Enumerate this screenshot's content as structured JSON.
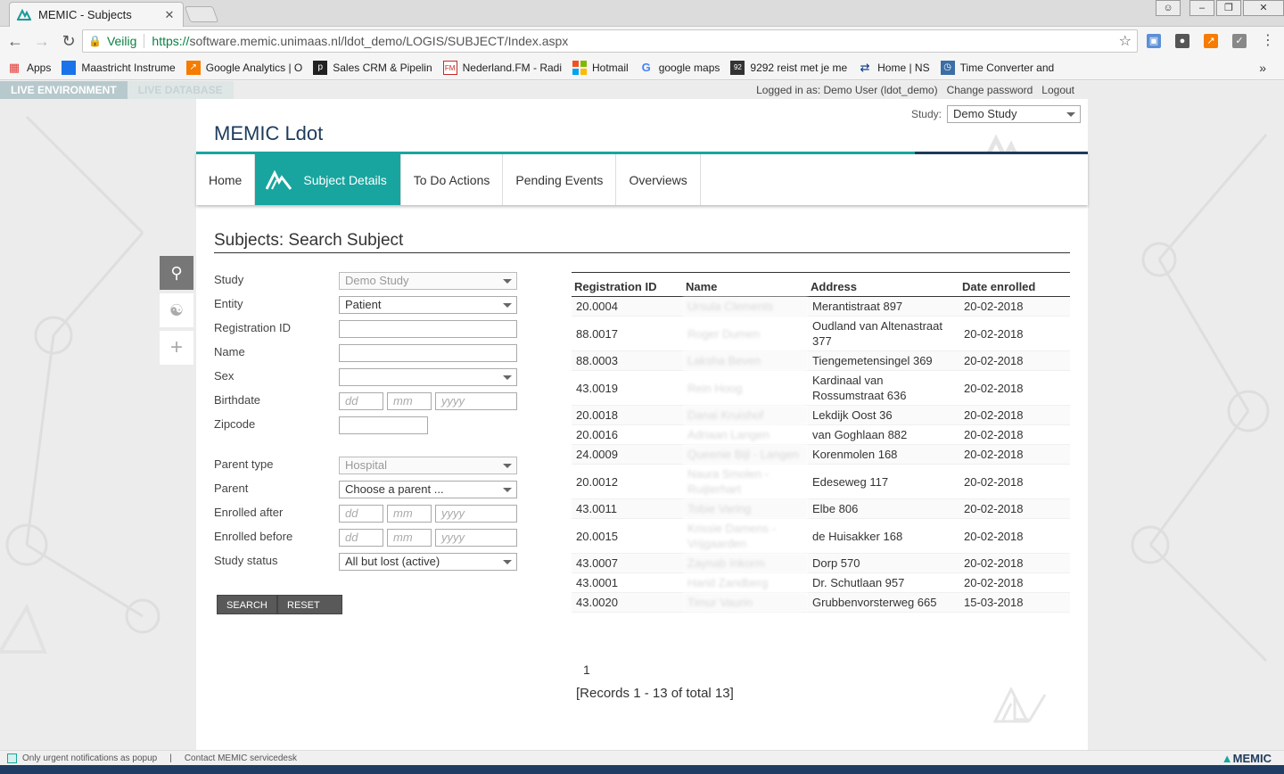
{
  "browser": {
    "tab_title": "MEMIC - Subjects",
    "tab_close": "✕",
    "secure_label": "Veilig",
    "url_protocol": "https://",
    "url_host": "software.memic.unimaas.nl",
    "url_path": "/ldot_demo/LOGIS/SUBJECT/Index.aspx",
    "bookmarks": [
      {
        "label": "Apps",
        "icon": "apps-grid-icon",
        "color": "#4285f4"
      },
      {
        "label": "Maastricht Instrume",
        "icon": "maastricht-icon",
        "color": "#1a73e8"
      },
      {
        "label": "Google Analytics | O",
        "icon": "analytics-icon",
        "color": "#f57c00"
      },
      {
        "label": "Sales CRM & Pipelin",
        "icon": "pipedrive-icon",
        "color": "#222222"
      },
      {
        "label": "Nederland.FM - Radi",
        "icon": "nederland-fm-icon",
        "color": "#c62828"
      },
      {
        "label": "Hotmail",
        "icon": "windows-icon",
        "color": "#00a4ef"
      },
      {
        "label": "google maps",
        "icon": "google-icon",
        "color": "#4285f4"
      },
      {
        "label": "9292 reist met je me",
        "icon": "9292-icon",
        "color": "#333333"
      },
      {
        "label": "Home | NS",
        "icon": "ns-icon",
        "color": "#003082"
      },
      {
        "label": "Time Converter and",
        "icon": "clock-icon",
        "color": "#3b6ea5"
      }
    ],
    "bookmarks_more": "»"
  },
  "env": {
    "live_environment": "LIVE ENVIRONMENT",
    "live_database": "LIVE DATABASE"
  },
  "userbar": {
    "logged_in": "Logged in as: Demo User (ldot_demo)",
    "change_password": "Change password",
    "logout": "Logout"
  },
  "header": {
    "study_label": "Study:",
    "study_value": "Demo Study",
    "app_title": "MEMIC Ldot"
  },
  "nav": {
    "home": "Home",
    "subject_details": "Subject Details",
    "todo": "To Do Actions",
    "pending": "Pending Events",
    "overviews": "Overviews"
  },
  "page_title": "Subjects:  Search Subject",
  "form": {
    "study_label": "Study",
    "study_value": "Demo Study",
    "entity_label": "Entity",
    "entity_value": "Patient",
    "regid_label": "Registration ID",
    "name_label": "Name",
    "sex_label": "Sex",
    "birthdate_label": "Birthdate",
    "zipcode_label": "Zipcode",
    "parent_type_label": "Parent type",
    "parent_type_value": "Hospital",
    "parent_label": "Parent",
    "parent_value": "Choose a parent ...",
    "enrolled_after_label": "Enrolled after",
    "enrolled_before_label": "Enrolled before",
    "study_status_label": "Study status",
    "study_status_value": "All but lost (active)",
    "dd": "dd",
    "mm": "mm",
    "yyyy": "yyyy",
    "search_button": "SEARCH",
    "reset_button": "RESET SEARCH CRITERIA"
  },
  "table": {
    "headers": [
      "Registration ID",
      "Name",
      "Address",
      "Date enrolled"
    ],
    "rows": [
      {
        "id": "20.0004",
        "name": "Ursula Clements",
        "address": "Merantistraat 897",
        "date": "20-02-2018"
      },
      {
        "id": "88.0017",
        "name": "Roger Dumen",
        "address": "Oudland van Altenastraat 377",
        "date": "20-02-2018"
      },
      {
        "id": "88.0003",
        "name": "Laksha Beven",
        "address": "Tiengemetensingel 369",
        "date": "20-02-2018"
      },
      {
        "id": "43.0019",
        "name": "Rein Hoog",
        "address": "Kardinaal van Rossumstraat 636",
        "date": "20-02-2018"
      },
      {
        "id": "20.0018",
        "name": "Danai Kruishof",
        "address": "Lekdijk Oost 36",
        "date": "20-02-2018"
      },
      {
        "id": "20.0016",
        "name": "Adriaan Langen",
        "address": "van Goghlaan 882",
        "date": "20-02-2018"
      },
      {
        "id": "24.0009",
        "name": "Queenie Bijl - Langen",
        "address": "Korenmolen 168",
        "date": "20-02-2018"
      },
      {
        "id": "20.0012",
        "name": "Naura Smolen - Ruijterhart",
        "address": "Edeseweg 117",
        "date": "20-02-2018"
      },
      {
        "id": "43.0011",
        "name": "Tobie Varing",
        "address": "Elbe 806",
        "date": "20-02-2018"
      },
      {
        "id": "20.0015",
        "name": "Krissie Damens - Vrijgaarden",
        "address": "de Huisakker 168",
        "date": "20-02-2018"
      },
      {
        "id": "43.0007",
        "name": "Zaynab Inkorm",
        "address": "Dorp 570",
        "date": "20-02-2018"
      },
      {
        "id": "43.0001",
        "name": "Harid Zandberg",
        "address": "Dr. Schutlaan 957",
        "date": "20-02-2018"
      },
      {
        "id": "43.0020",
        "name": "Timur Vaurin",
        "address": "Grubbenvorsterweg 665",
        "date": "15-03-2018"
      }
    ],
    "page": "1",
    "records": "[Records 1 - 13 of total 13]"
  },
  "statusbar": {
    "notify": "Only urgent notifications as popup",
    "sep": "|",
    "contact": "Contact MEMIC servicedesk",
    "brand": "MEMIC"
  },
  "colors": {
    "accent": "#19a59f",
    "navy": "#1d3b5c"
  }
}
